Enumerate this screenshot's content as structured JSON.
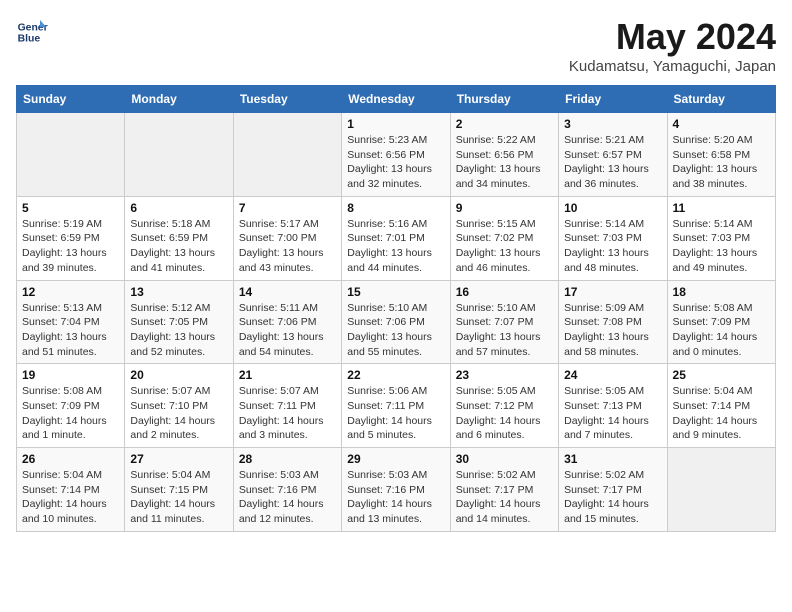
{
  "header": {
    "logo_line1": "General",
    "logo_line2": "Blue",
    "month": "May 2024",
    "location": "Kudamatsu, Yamaguchi, Japan"
  },
  "weekdays": [
    "Sunday",
    "Monday",
    "Tuesday",
    "Wednesday",
    "Thursday",
    "Friday",
    "Saturday"
  ],
  "weeks": [
    [
      {
        "day": "",
        "info": ""
      },
      {
        "day": "",
        "info": ""
      },
      {
        "day": "",
        "info": ""
      },
      {
        "day": "1",
        "info": "Sunrise: 5:23 AM\nSunset: 6:56 PM\nDaylight: 13 hours\nand 32 minutes."
      },
      {
        "day": "2",
        "info": "Sunrise: 5:22 AM\nSunset: 6:56 PM\nDaylight: 13 hours\nand 34 minutes."
      },
      {
        "day": "3",
        "info": "Sunrise: 5:21 AM\nSunset: 6:57 PM\nDaylight: 13 hours\nand 36 minutes."
      },
      {
        "day": "4",
        "info": "Sunrise: 5:20 AM\nSunset: 6:58 PM\nDaylight: 13 hours\nand 38 minutes."
      }
    ],
    [
      {
        "day": "5",
        "info": "Sunrise: 5:19 AM\nSunset: 6:59 PM\nDaylight: 13 hours\nand 39 minutes."
      },
      {
        "day": "6",
        "info": "Sunrise: 5:18 AM\nSunset: 6:59 PM\nDaylight: 13 hours\nand 41 minutes."
      },
      {
        "day": "7",
        "info": "Sunrise: 5:17 AM\nSunset: 7:00 PM\nDaylight: 13 hours\nand 43 minutes."
      },
      {
        "day": "8",
        "info": "Sunrise: 5:16 AM\nSunset: 7:01 PM\nDaylight: 13 hours\nand 44 minutes."
      },
      {
        "day": "9",
        "info": "Sunrise: 5:15 AM\nSunset: 7:02 PM\nDaylight: 13 hours\nand 46 minutes."
      },
      {
        "day": "10",
        "info": "Sunrise: 5:14 AM\nSunset: 7:03 PM\nDaylight: 13 hours\nand 48 minutes."
      },
      {
        "day": "11",
        "info": "Sunrise: 5:14 AM\nSunset: 7:03 PM\nDaylight: 13 hours\nand 49 minutes."
      }
    ],
    [
      {
        "day": "12",
        "info": "Sunrise: 5:13 AM\nSunset: 7:04 PM\nDaylight: 13 hours\nand 51 minutes."
      },
      {
        "day": "13",
        "info": "Sunrise: 5:12 AM\nSunset: 7:05 PM\nDaylight: 13 hours\nand 52 minutes."
      },
      {
        "day": "14",
        "info": "Sunrise: 5:11 AM\nSunset: 7:06 PM\nDaylight: 13 hours\nand 54 minutes."
      },
      {
        "day": "15",
        "info": "Sunrise: 5:10 AM\nSunset: 7:06 PM\nDaylight: 13 hours\nand 55 minutes."
      },
      {
        "day": "16",
        "info": "Sunrise: 5:10 AM\nSunset: 7:07 PM\nDaylight: 13 hours\nand 57 minutes."
      },
      {
        "day": "17",
        "info": "Sunrise: 5:09 AM\nSunset: 7:08 PM\nDaylight: 13 hours\nand 58 minutes."
      },
      {
        "day": "18",
        "info": "Sunrise: 5:08 AM\nSunset: 7:09 PM\nDaylight: 14 hours\nand 0 minutes."
      }
    ],
    [
      {
        "day": "19",
        "info": "Sunrise: 5:08 AM\nSunset: 7:09 PM\nDaylight: 14 hours\nand 1 minute."
      },
      {
        "day": "20",
        "info": "Sunrise: 5:07 AM\nSunset: 7:10 PM\nDaylight: 14 hours\nand 2 minutes."
      },
      {
        "day": "21",
        "info": "Sunrise: 5:07 AM\nSunset: 7:11 PM\nDaylight: 14 hours\nand 3 minutes."
      },
      {
        "day": "22",
        "info": "Sunrise: 5:06 AM\nSunset: 7:11 PM\nDaylight: 14 hours\nand 5 minutes."
      },
      {
        "day": "23",
        "info": "Sunrise: 5:05 AM\nSunset: 7:12 PM\nDaylight: 14 hours\nand 6 minutes."
      },
      {
        "day": "24",
        "info": "Sunrise: 5:05 AM\nSunset: 7:13 PM\nDaylight: 14 hours\nand 7 minutes."
      },
      {
        "day": "25",
        "info": "Sunrise: 5:04 AM\nSunset: 7:14 PM\nDaylight: 14 hours\nand 9 minutes."
      }
    ],
    [
      {
        "day": "26",
        "info": "Sunrise: 5:04 AM\nSunset: 7:14 PM\nDaylight: 14 hours\nand 10 minutes."
      },
      {
        "day": "27",
        "info": "Sunrise: 5:04 AM\nSunset: 7:15 PM\nDaylight: 14 hours\nand 11 minutes."
      },
      {
        "day": "28",
        "info": "Sunrise: 5:03 AM\nSunset: 7:16 PM\nDaylight: 14 hours\nand 12 minutes."
      },
      {
        "day": "29",
        "info": "Sunrise: 5:03 AM\nSunset: 7:16 PM\nDaylight: 14 hours\nand 13 minutes."
      },
      {
        "day": "30",
        "info": "Sunrise: 5:02 AM\nSunset: 7:17 PM\nDaylight: 14 hours\nand 14 minutes."
      },
      {
        "day": "31",
        "info": "Sunrise: 5:02 AM\nSunset: 7:17 PM\nDaylight: 14 hours\nand 15 minutes."
      },
      {
        "day": "",
        "info": ""
      }
    ]
  ]
}
